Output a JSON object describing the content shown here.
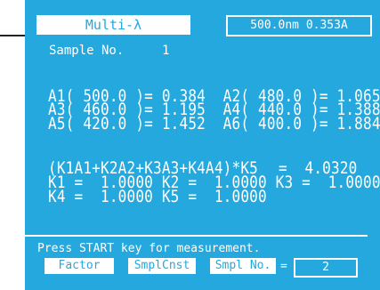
{
  "header": {
    "title": "Multi-λ",
    "wavelength_readout": "500.0nm  0.353A"
  },
  "sample": {
    "label": "Sample No.",
    "value": "1"
  },
  "readings": {
    "row1": "A1( 500.0 )= 0.384  A2( 480.0 )= 1.065",
    "row2": "A3( 460.0 )= 1.195  A4( 440.0 )= 1.388",
    "row3": "A5( 420.0 )= 1.452  A6( 400.0 )= 1.884"
  },
  "formula": {
    "expression": "(K1A1+K2A2+K3A3+K4A4)*K5",
    "result": "=  4.0320",
    "factors_row1": "K1 =  1.0000 K2 =  1.0000 K3 =  1.0000",
    "factors_row2": "K4 =  1.0000 K5 =  1.0000"
  },
  "status": {
    "message": "Press START key for measurement."
  },
  "softkeys": {
    "factor": "Factor",
    "smpl_cnst": "SmplCnst",
    "smpl_no": "Smpl No.",
    "equals": "=",
    "smpl_no_value": "2"
  },
  "colors": {
    "screen_bg": "#24a8dd",
    "fg": "#ffffff"
  }
}
